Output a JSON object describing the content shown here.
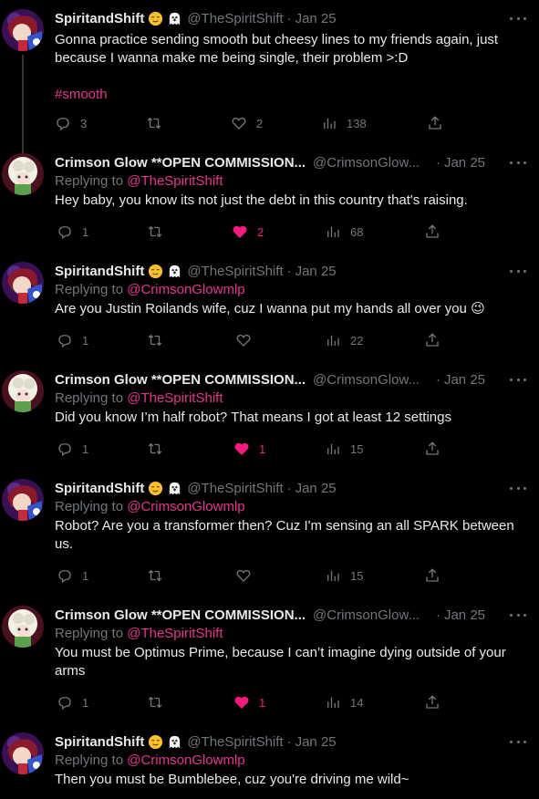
{
  "tweets": [
    {
      "name": "SpiritandShift",
      "handle": "@TheSpiritShift",
      "date": "Jan 25",
      "text": "Gonna practice sending smooth but cheesy lines to my friends again, just because I wanna make me being single, their problem >:D",
      "hashtag": "#smooth",
      "replies": "3",
      "retweets": "",
      "likes": "2",
      "views": "138"
    },
    {
      "name": "Crimson Glow **OPEN COMMISSION...",
      "handle": "@CrimsonGlow...",
      "date": "Jan 25",
      "replying_label": "Replying to",
      "replying_to": "@TheSpiritShift",
      "text": "Hey baby, you know its not just the debt in this country that's raising.",
      "replies": "1",
      "retweets": "",
      "likes": "2",
      "views": "68"
    },
    {
      "name": "SpiritandShift",
      "handle": "@TheSpiritShift",
      "date": "Jan 25",
      "replying_label": "Replying to",
      "replying_to": "@CrimsonGlowmlp",
      "text": "Are you Justin Roilands wife, cuz I wanna put my hands all over you 😉",
      "replies": "1",
      "retweets": "",
      "likes": "",
      "views": "22"
    },
    {
      "name": "Crimson Glow **OPEN COMMISSION...",
      "handle": "@CrimsonGlow...",
      "date": "Jan 25",
      "replying_label": "Replying to",
      "replying_to": "@TheSpiritShift",
      "text": "Did you know I’m half robot? That means I got at least 12 settings",
      "replies": "1",
      "retweets": "",
      "likes": "1",
      "views": "15"
    },
    {
      "name": "SpiritandShift",
      "handle": "@TheSpiritShift",
      "date": "Jan 25",
      "replying_label": "Replying to",
      "replying_to": "@CrimsonGlowmlp",
      "text": "Robot? Are you a transformer then? Cuz I'm sensing an all SPARK between us.",
      "replies": "1",
      "retweets": "",
      "likes": "",
      "views": "15"
    },
    {
      "name": "Crimson Glow **OPEN COMMISSION...",
      "handle": "@CrimsonGlow...",
      "date": "Jan 25",
      "replying_label": "Replying to",
      "replying_to": "@TheSpiritShift",
      "text": "You must be Optimus Prime, because I can’t imagine dying outside of your arms",
      "replies": "1",
      "retweets": "",
      "likes": "1",
      "views": "14"
    },
    {
      "name": "SpiritandShift",
      "handle": "@TheSpiritShift",
      "date": "Jan 25",
      "replying_label": "Replying to",
      "replying_to": "@CrimsonGlowmlp",
      "text": "Then you must be Bumblebee, cuz you're driving me wild~"
    }
  ],
  "colors": {
    "background": "#000000",
    "text": "#e7e9ea",
    "muted": "#71767b",
    "accent": "#e8338f",
    "like": "#f91880"
  },
  "icons": {
    "reply": "reply-icon",
    "retweet": "retweet-icon",
    "like": "heart-icon",
    "views": "views-icon",
    "share": "share-icon",
    "more": "more-icon"
  }
}
